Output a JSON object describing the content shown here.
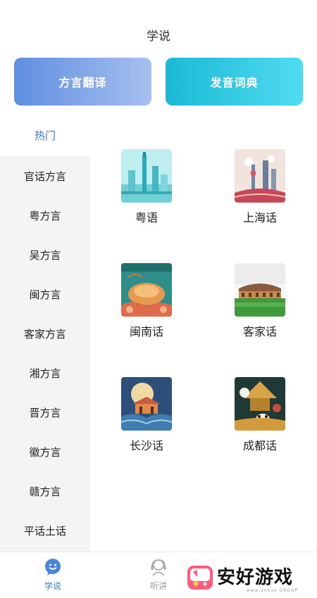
{
  "header": {
    "title": "学说"
  },
  "features": {
    "left_label": "方言翻译",
    "right_label": "发音词典"
  },
  "sidebar": {
    "items": [
      {
        "label": "热门",
        "active": true
      },
      {
        "label": "官话方言"
      },
      {
        "label": "粤方言"
      },
      {
        "label": "吴方言"
      },
      {
        "label": "闽方言"
      },
      {
        "label": "客家方言"
      },
      {
        "label": "湘方言"
      },
      {
        "label": "晋方言"
      },
      {
        "label": "徽方言"
      },
      {
        "label": "赣方言"
      },
      {
        "label": "平话土话"
      }
    ]
  },
  "dialects": [
    {
      "label": "粤语"
    },
    {
      "label": "上海话"
    },
    {
      "label": "闽南话"
    },
    {
      "label": "客家话"
    },
    {
      "label": "长沙话"
    },
    {
      "label": "成都话"
    }
  ],
  "tabbar": {
    "tab1_label": "学说",
    "tab2_label": "听讲"
  },
  "watermark": {
    "text": "安好游戏",
    "sub": "www.anhao GROUP"
  },
  "colors": {
    "active_blue": "#3a79c4",
    "sidebar_bg": "#f4f4f4"
  }
}
